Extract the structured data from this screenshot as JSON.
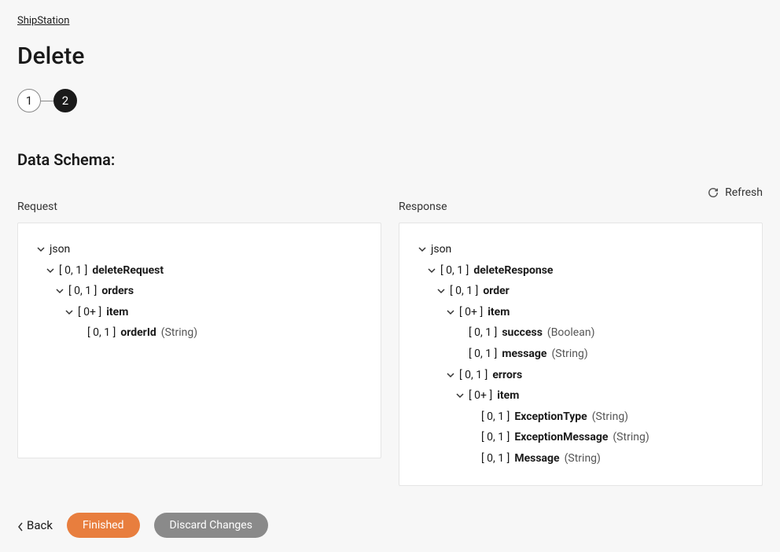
{
  "breadcrumb": "ShipStation",
  "pageTitle": "Delete",
  "stepper": {
    "step1": "1",
    "step2": "2"
  },
  "sectionTitle": "Data Schema:",
  "refreshLabel": "Refresh",
  "requestLabel": "Request",
  "responseLabel": "Response",
  "back": "Back",
  "finished": "Finished",
  "discard": "Discard Changes",
  "requestTree": {
    "root": "json",
    "n1_card": "[ 0, 1 ]",
    "n1_name": "deleteRequest",
    "n2_card": "[ 0, 1 ]",
    "n2_name": "orders",
    "n3_card": "[ 0+ ]",
    "n3_name": "item",
    "n4_card": "[ 0, 1 ]",
    "n4_name": "orderId",
    "n4_type": "(String)"
  },
  "responseTree": {
    "root": "json",
    "n1_card": "[ 0, 1 ]",
    "n1_name": "deleteResponse",
    "n2_card": "[ 0, 1 ]",
    "n2_name": "order",
    "n3_card": "[ 0+ ]",
    "n3_name": "item",
    "n4_card": "[ 0, 1 ]",
    "n4_name": "success",
    "n4_type": "(Boolean)",
    "n5_card": "[ 0, 1 ]",
    "n5_name": "message",
    "n5_type": "(String)",
    "n6_card": "[ 0, 1 ]",
    "n6_name": "errors",
    "n7_card": "[ 0+ ]",
    "n7_name": "item",
    "n8_card": "[ 0, 1 ]",
    "n8_name": "ExceptionType",
    "n8_type": "(String)",
    "n9_card": "[ 0, 1 ]",
    "n9_name": "ExceptionMessage",
    "n9_type": "(String)",
    "n10_card": "[ 0, 1 ]",
    "n10_name": "Message",
    "n10_type": "(String)"
  }
}
